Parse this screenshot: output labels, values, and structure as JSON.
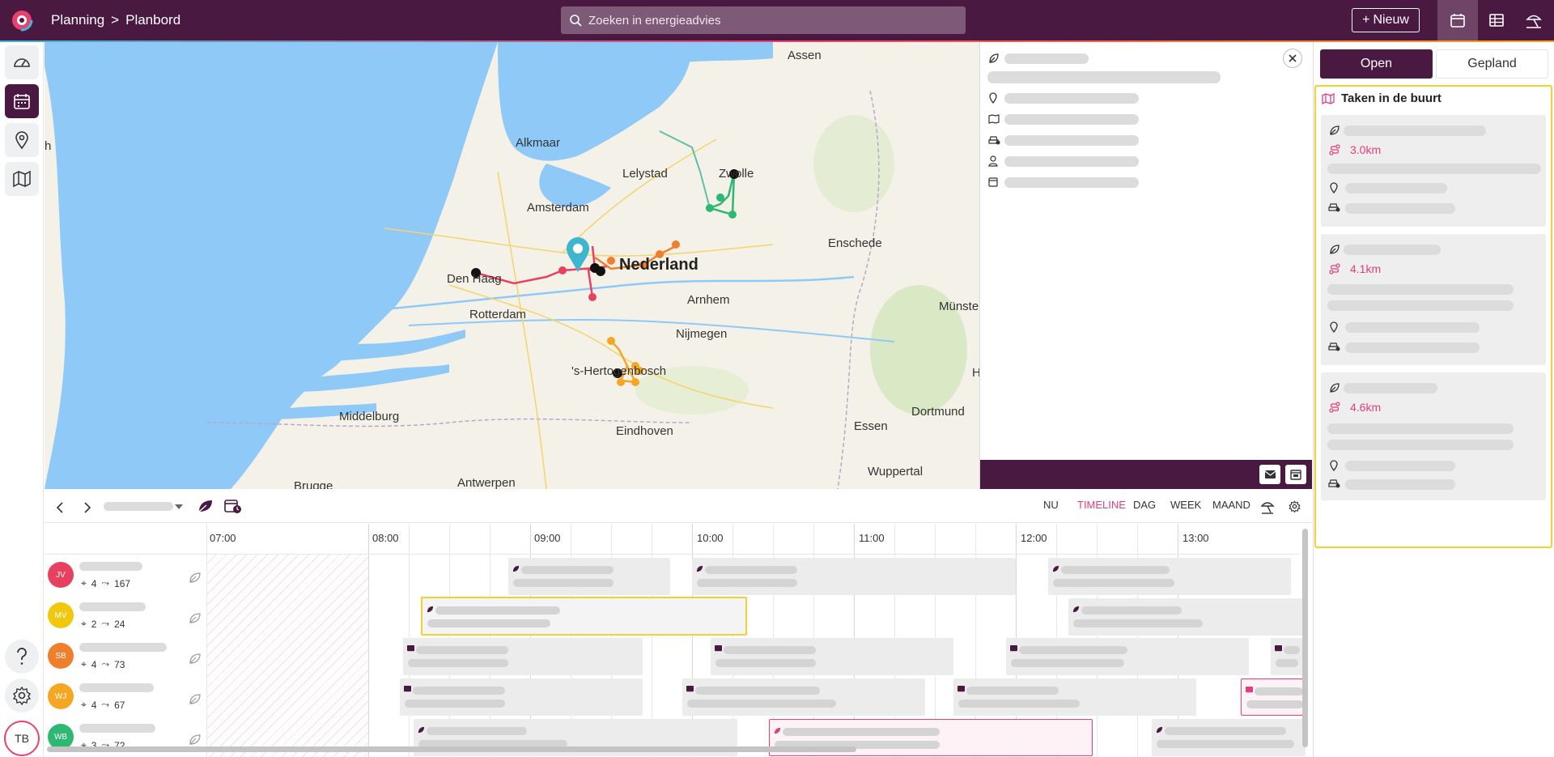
{
  "app": {
    "breadcrumb": {
      "section": "Planning",
      "separator": ">",
      "page": "Planbord"
    },
    "search_placeholder": "Zoeken in energieadvies",
    "new_button": "Nieuw",
    "new_plus": "+",
    "brand_color": "#4a1942",
    "accent_color": "#e23d7c"
  },
  "user": {
    "initials": "TB"
  },
  "map": {
    "labels": [
      "Assen",
      "Alkmaar",
      "Lelystad",
      "Zwolle",
      "Amsterdam",
      "Nederland",
      "Enschede",
      "Den Haag",
      "Arnhem",
      "Rotterdam",
      "Nijmegen",
      "Münster",
      "'s-Hertogenbosch",
      "Middelburg",
      "Eindhoven",
      "Essen",
      "Dortmund",
      "Wuppertal",
      "Brugge",
      "Antwerpen",
      "h",
      "H"
    ]
  },
  "right_panel": {
    "tabs": [
      {
        "label": "Open"
      },
      {
        "label": "Gepland"
      }
    ],
    "nearby_title": "Taken in de buurt",
    "cards": [
      {
        "distance": "3.0km"
      },
      {
        "distance": "4.1km"
      },
      {
        "distance": "4.6km"
      }
    ]
  },
  "timeline": {
    "views": [
      "NU",
      "TIMELINE",
      "DAG",
      "WEEK",
      "MAAND"
    ],
    "active_view": "TIMELINE",
    "hours": [
      "07:00",
      "08:00",
      "09:00",
      "10:00",
      "11:00",
      "12:00",
      "13:00"
    ],
    "people": [
      {
        "initials": "JV",
        "color": "#e8415f",
        "locations": "4",
        "distance": "167"
      },
      {
        "initials": "MV",
        "color": "#f2c80f",
        "locations": "2",
        "distance": "24"
      },
      {
        "initials": "SB",
        "color": "#f07f2c",
        "locations": "4",
        "distance": "73"
      },
      {
        "initials": "WJ",
        "color": "#f5a623",
        "locations": "4",
        "distance": "67"
      },
      {
        "initials": "WB",
        "color": "#2eb872",
        "locations": "3",
        "distance": "72"
      }
    ]
  }
}
